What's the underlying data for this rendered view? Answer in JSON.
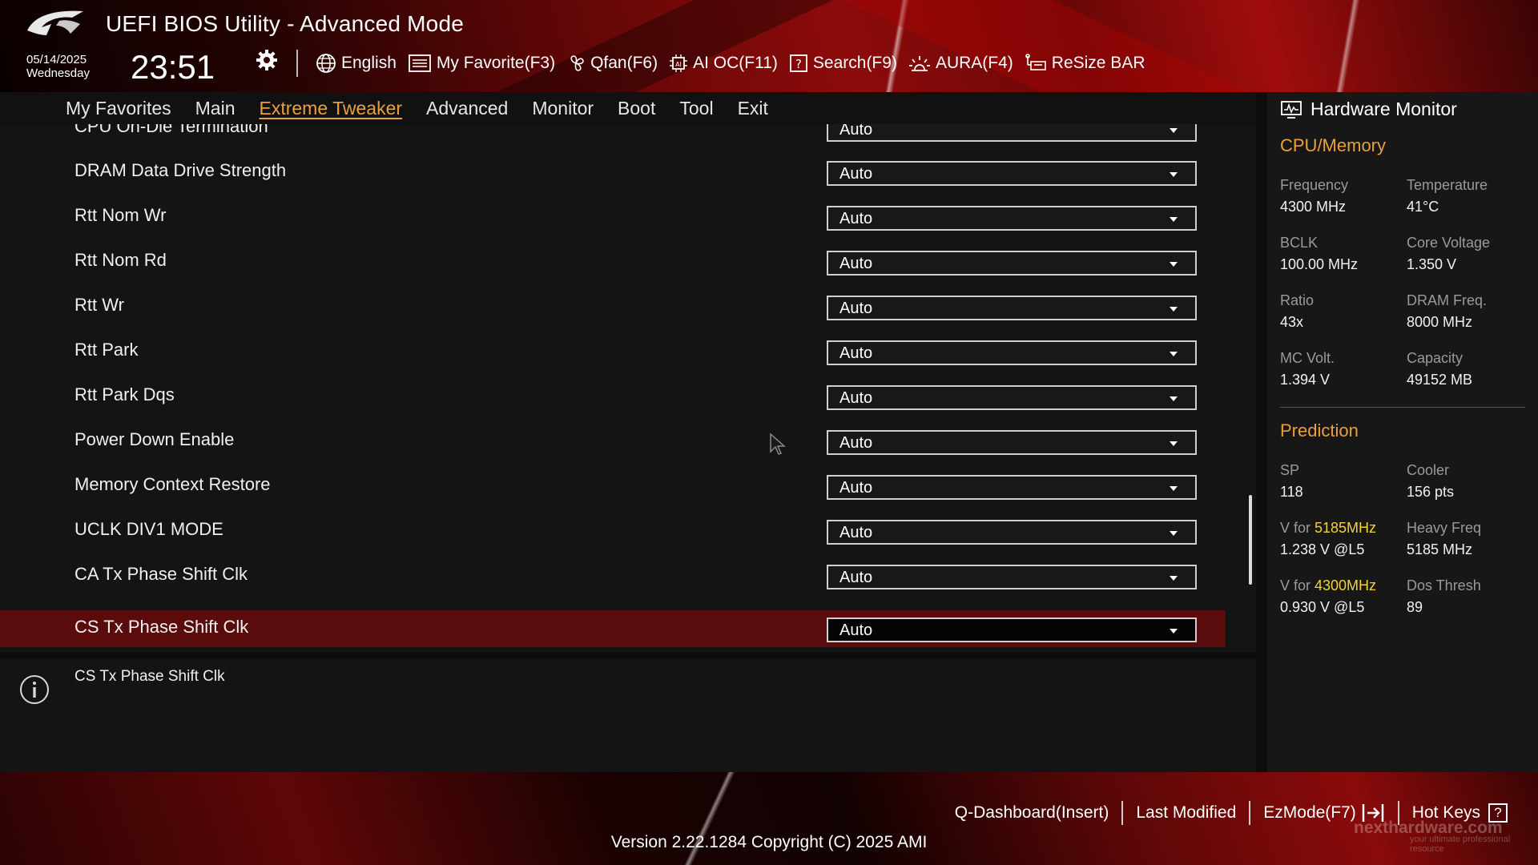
{
  "header": {
    "title": "UEFI BIOS Utility - Advanced Mode",
    "date": "05/14/2025",
    "day": "Wednesday",
    "time": "23:51"
  },
  "toolbar": [
    {
      "label": "English",
      "icon": "globe-icon"
    },
    {
      "label": "My Favorite(F3)",
      "icon": "favorite-list-icon"
    },
    {
      "label": "Qfan(F6)",
      "icon": "fan-icon"
    },
    {
      "label": "AI OC(F11)",
      "icon": "ai-chip-icon"
    },
    {
      "label": "Search(F9)",
      "icon": "search-help-icon"
    },
    {
      "label": "AURA(F4)",
      "icon": "aura-light-icon"
    },
    {
      "label": "ReSize BAR",
      "icon": "resize-bar-icon"
    }
  ],
  "menu": {
    "items": [
      "My Favorites",
      "Main",
      "Extreme Tweaker",
      "Advanced",
      "Monitor",
      "Boot",
      "Tool",
      "Exit"
    ],
    "active": "Extreme Tweaker"
  },
  "settings": [
    {
      "label": "CPU On-Die Termination",
      "value": "Auto"
    },
    {
      "label": "DRAM Data Drive Strength",
      "value": "Auto"
    },
    {
      "label": "Rtt Nom Wr",
      "value": "Auto"
    },
    {
      "label": "Rtt Nom Rd",
      "value": "Auto"
    },
    {
      "label": "Rtt Wr",
      "value": "Auto"
    },
    {
      "label": "Rtt Park",
      "value": "Auto"
    },
    {
      "label": "Rtt Park Dqs",
      "value": "Auto"
    },
    {
      "label": "Power Down Enable",
      "value": "Auto"
    },
    {
      "label": "Memory Context Restore",
      "value": "Auto"
    },
    {
      "label": "UCLK DIV1 MODE",
      "value": "Auto"
    },
    {
      "label": "CA Tx Phase Shift Clk",
      "value": "Auto"
    },
    {
      "label": "CS Tx Phase Shift Clk",
      "value": "Auto",
      "selected": true
    }
  ],
  "info": {
    "text": "CS Tx Phase Shift Clk"
  },
  "hardware_monitor": {
    "title": "Hardware Monitor",
    "cpu_memory": {
      "heading": "CPU/Memory",
      "items": [
        {
          "key": "Frequency",
          "value": "4300 MHz"
        },
        {
          "key": "Temperature",
          "value": "41°C"
        },
        {
          "key": "BCLK",
          "value": "100.00 MHz"
        },
        {
          "key": "Core Voltage",
          "value": "1.350 V"
        },
        {
          "key": "Ratio",
          "value": "43x"
        },
        {
          "key": "DRAM Freq.",
          "value": "8000 MHz"
        },
        {
          "key": "MC Volt.",
          "value": "1.394 V"
        },
        {
          "key": "Capacity",
          "value": "49152 MB"
        }
      ]
    },
    "prediction": {
      "heading": "Prediction",
      "items": [
        {
          "key": "SP",
          "value": "118"
        },
        {
          "key": "Cooler",
          "value": "156 pts"
        },
        {
          "key_prefix": "V for ",
          "key_highlight": "5185MHz",
          "value": "1.238 V @L5"
        },
        {
          "key": "Heavy Freq",
          "value": "5185 MHz"
        },
        {
          "key_prefix": "V for ",
          "key_highlight": "4300MHz",
          "value": "0.930 V @L5"
        },
        {
          "key": "Dos Thresh",
          "value": "89"
        }
      ]
    },
    "highlight_color": "#f3d23a",
    "accent_color": "#e9a13b"
  },
  "footer": {
    "links": [
      "Q-Dashboard(Insert)",
      "Last Modified",
      "EzMode(F7)",
      "Hot Keys"
    ],
    "hotkeys_icon": "?",
    "version": "Version 2.22.1284 Copyright (C) 2025 AMI",
    "watermark": "nexthardware.com",
    "watermark_tagline": "your ultimate professional resource"
  }
}
